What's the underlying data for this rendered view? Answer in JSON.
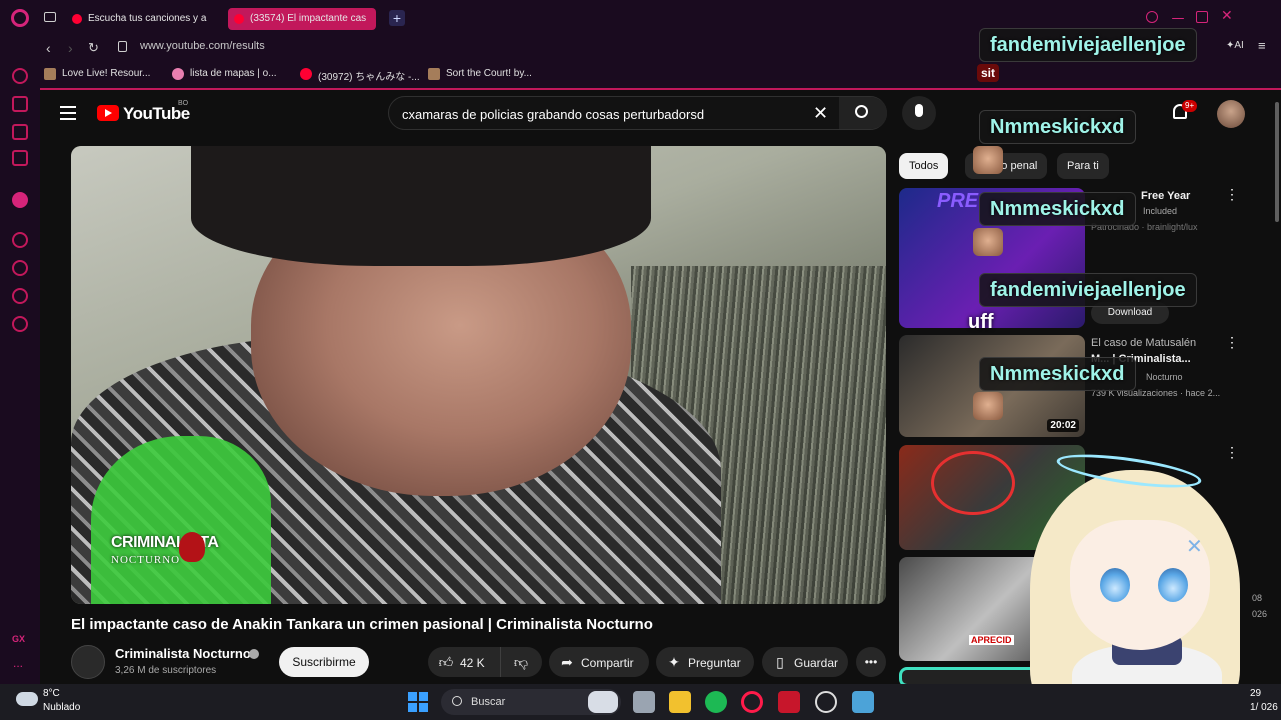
{
  "browser": {
    "tabs": [
      {
        "label": "Escucha tus canciones y a"
      },
      {
        "label": "(33574) El impactante cas"
      }
    ],
    "new_tab": "+",
    "url": "www.youtube.com/results",
    "ai_label": "AI",
    "bookmarks": [
      {
        "label": "Love Live! Resour..."
      },
      {
        "label": "lista de mapas | o..."
      },
      {
        "label": "(30972) ちゃんみな -..."
      },
      {
        "label": "Sort the Court! by..."
      }
    ],
    "sidebar_footer": "GX",
    "sidebar_more": "..."
  },
  "youtube": {
    "logo_text": "YouTube",
    "country_code": "BO",
    "search_query": "cxamaras de policias grabando cosas perturbadorsd",
    "notifications_badge": "9+",
    "video": {
      "title": "El impactante caso de Anakin Tankara un crimen pasional | Criminalista Nocturno",
      "watermark_line1": "CRIMINALISTA",
      "watermark_line2": "NOCTURNO",
      "channel_name": "Criminalista Nocturno",
      "subscribers": "3,26 M de suscriptores",
      "subscribe_label": "Suscribirme",
      "like_count": "42 K",
      "share_label": "Compartir",
      "ask_label": "Preguntar",
      "save_label": "Guardar"
    },
    "chips": [
      "Todos",
      "De... o penal",
      "Para ti"
    ],
    "recommendations": [
      {
        "thumb_text": "PRE",
        "title": "Free Year",
        "meta": "Included",
        "sponsor": "Patrocinado · brainlight/lux",
        "cta": "Download"
      },
      {
        "title_line1": "El caso de Matusalén",
        "title_line2": "M... | Criminalista...",
        "channel": "Nocturno",
        "views": "739 K visualizaciones · hace 2...",
        "duration": "20:02"
      },
      {},
      {
        "thumb_label": "APRECID"
      },
      {}
    ],
    "side_snippets": [
      "08",
      "026"
    ]
  },
  "overlay": {
    "chat": [
      {
        "text": "fandemiviejaellenjoe"
      },
      {
        "text": "sit"
      },
      {
        "text": "Nmmeskickxd"
      },
      {
        "text": "Nmmeskickxd"
      },
      {
        "text": "fandemiviejaellenjoe"
      },
      {
        "text": "uff"
      },
      {
        "text": "Nmmeskickxd"
      }
    ]
  },
  "taskbar": {
    "temperature": "8°C",
    "condition": "Nublado",
    "search_label": "Buscar",
    "time": "29",
    "date": "1/ 026"
  },
  "colors": {
    "opera_accent": "#c2185b",
    "youtube_red": "#ff0000",
    "chat_text": "#9ff3e8"
  }
}
